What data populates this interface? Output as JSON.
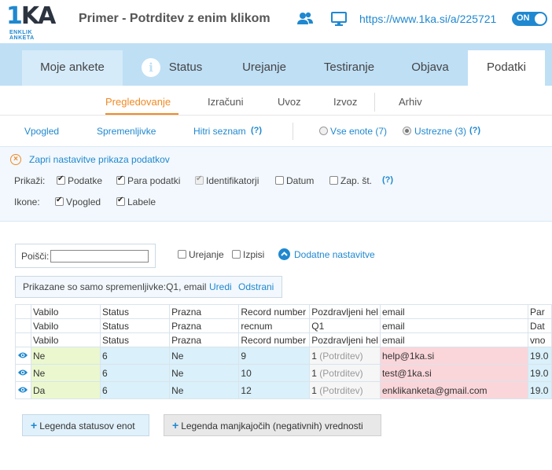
{
  "header": {
    "logo_text": "1KA",
    "logo_sub": "ENKLIK ANKETA",
    "title": "Primer - Potrditev z enim klikom",
    "url": "https://www.1ka.si/a/225721",
    "toggle": "ON"
  },
  "nav": {
    "home": "Moje ankete",
    "tabs": [
      "Status",
      "Urejanje",
      "Testiranje",
      "Objava",
      "Podatki"
    ]
  },
  "subnav": {
    "tabs": [
      "Pregledovanje",
      "Izračuni",
      "Uvoz",
      "Izvoz",
      "Arhiv"
    ]
  },
  "viewbar": {
    "links": [
      "Vpogled",
      "Spremenljivke",
      "Hitri seznam"
    ],
    "quick_help": "(?)",
    "radio_all": "Vse enote (7)",
    "radio_valid": "Ustrezne (3)",
    "radio_help": "(?)"
  },
  "settings": {
    "close": "Zapri nastavitve prikaza podatkov",
    "show_label": "Prikaži:",
    "show_options": [
      "Podatke",
      "Para podatki",
      "Identifikatorji",
      "Datum",
      "Zap. št."
    ],
    "show_help": "(?)",
    "icons_label": "Ikone:",
    "icon_options": [
      "Vpogled",
      "Labele"
    ]
  },
  "search": {
    "label": "Poišči:",
    "value": "",
    "cb_edit": "Urejanje",
    "cb_print": "Izpisi",
    "advanced": "Dodatne nastavitve"
  },
  "varfilter": {
    "text": "Prikazane so samo spremenljivke:Q1, email",
    "edit": "Uredi",
    "remove": "Odstrani"
  },
  "table": {
    "header_rows": [
      [
        "Vabilo",
        "Status",
        "Prazna",
        "Record number",
        "Pozdravljeni hel",
        "email",
        "Par"
      ],
      [
        "Vabilo",
        "Status",
        "Prazna",
        "recnum",
        "Q1",
        "email",
        "Dat"
      ],
      [
        "Vabilo",
        "Status",
        "Prazna",
        "Record number",
        "Pozdravljeni hel",
        "email",
        "vno"
      ]
    ],
    "rows": [
      {
        "vabilo": "Ne",
        "status": "6",
        "prazna": "Ne",
        "recnum": "9",
        "q1_value": "1",
        "q1_label": "(Potrditev)",
        "email": "help@1ka.si",
        "par": "19.0"
      },
      {
        "vabilo": "Ne",
        "status": "6",
        "prazna": "Ne",
        "recnum": "10",
        "q1_value": "1",
        "q1_label": "(Potrditev)",
        "email": "test@1ka.si",
        "par": "19.0"
      },
      {
        "vabilo": "Da",
        "status": "6",
        "prazna": "Ne",
        "recnum": "12",
        "q1_value": "1",
        "q1_label": "(Potrditev)",
        "email": "enklikanketa@gmail.com",
        "par": "19.0"
      }
    ]
  },
  "buttons": {
    "legend_status": "Legenda statusov enot",
    "legend_missing": "Legenda manjkajočih (negativnih) vrednosti"
  },
  "colors": {
    "accent": "#1f88d0",
    "orange": "#f08a24",
    "nav_bg": "#bfdff5"
  }
}
